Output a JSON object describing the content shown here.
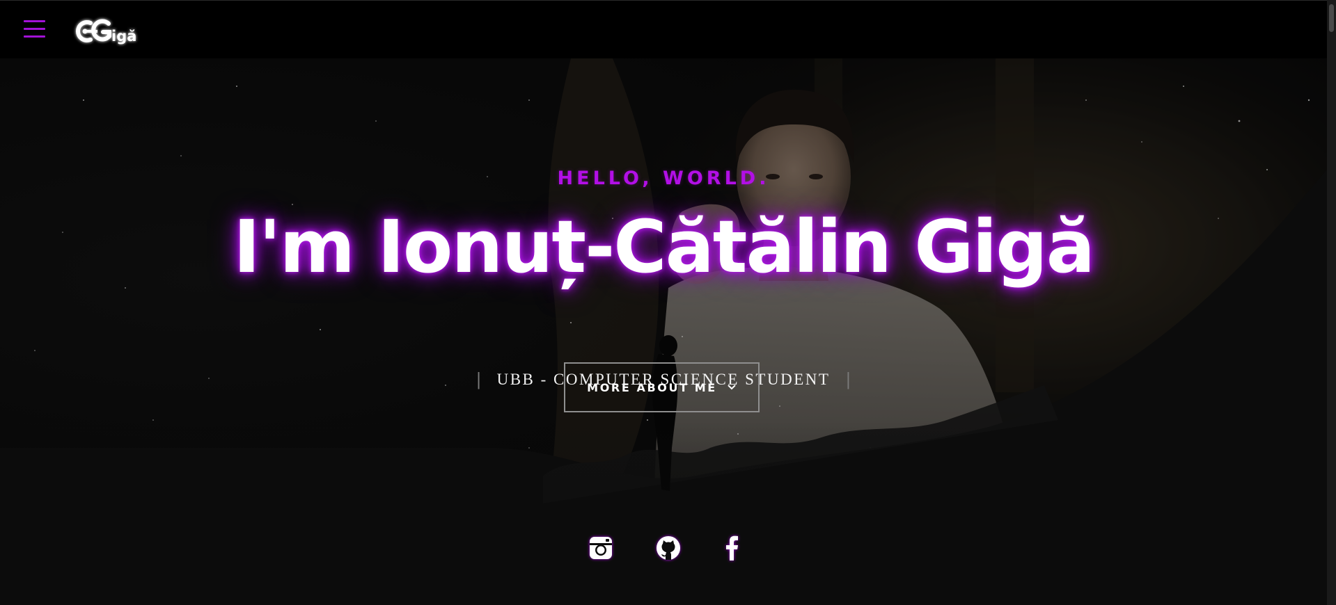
{
  "header": {
    "menu_icon": "hamburger-menu-icon",
    "logo_text": "CGigă"
  },
  "hero": {
    "pre_title": "HELLO, WORLD.",
    "title": "I'm Ionuț-Cătălin Gigă",
    "subtitle": "UBB - COMPUTER SCIENCE STUDENT",
    "cta_label": "MORE ABOUT ME",
    "cta_icon": "chevron-down-icon"
  },
  "socials": [
    {
      "icon": "instagram-icon"
    },
    {
      "icon": "github-icon"
    },
    {
      "icon": "facebook-icon"
    }
  ],
  "colors": {
    "accent": "#b20fe6",
    "glow": "#8d0cc4",
    "topbar_bg": "#000000",
    "page_bg": "#0c0c0c",
    "text": "#ffffff"
  }
}
